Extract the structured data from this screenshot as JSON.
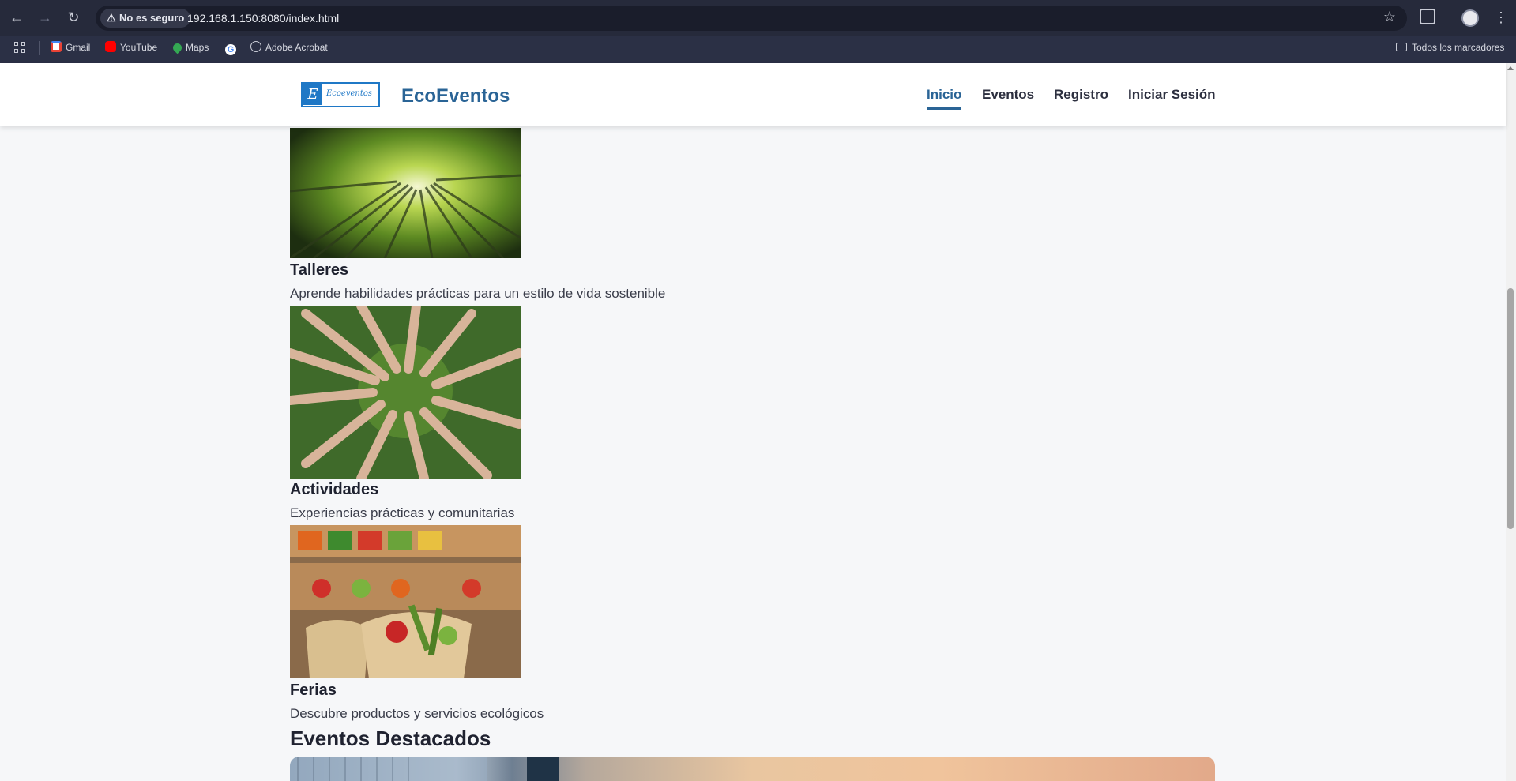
{
  "browser": {
    "security_label": "No es seguro",
    "url": "192.168.1.150:8080/index.html",
    "bookmarks": [
      {
        "label": "Gmail",
        "icon": "gmail-icon",
        "color": "#ea4335"
      },
      {
        "label": "YouTube",
        "icon": "youtube-icon",
        "color": "#ff0000"
      },
      {
        "label": "Maps",
        "icon": "maps-icon",
        "color": "#34a853"
      },
      {
        "label": "",
        "icon": "google-icon",
        "color": "#ffffff"
      },
      {
        "label": "Adobe Acrobat",
        "icon": "globe-icon",
        "color": "#c9ccd6"
      }
    ],
    "all_bookmarks_label": "Todos los marcadores"
  },
  "site": {
    "logo_text": "Ecoeventos",
    "logo_letter": "E",
    "brand": "EcoEventos",
    "nav": [
      "Inicio",
      "Eventos",
      "Registro",
      "Iniciar Sesión"
    ],
    "active_nav": "Inicio"
  },
  "categories": [
    {
      "title": "Talleres",
      "description": "Aprende habilidades prácticas para un estilo de vida sostenible",
      "image": "bamboo-forest-image"
    },
    {
      "title": "Actividades",
      "description": "Experiencias prácticas y comunitarias",
      "image": "feet-circle-grass-image"
    },
    {
      "title": "Ferias",
      "description": "Descubre productos y servicios ecológicos",
      "image": "market-produce-image"
    }
  ],
  "featured": {
    "title": "Eventos Destacados"
  },
  "colors": {
    "brand": "#2a6496",
    "logo": "#1f78c6",
    "background": "#f6f7f9"
  }
}
